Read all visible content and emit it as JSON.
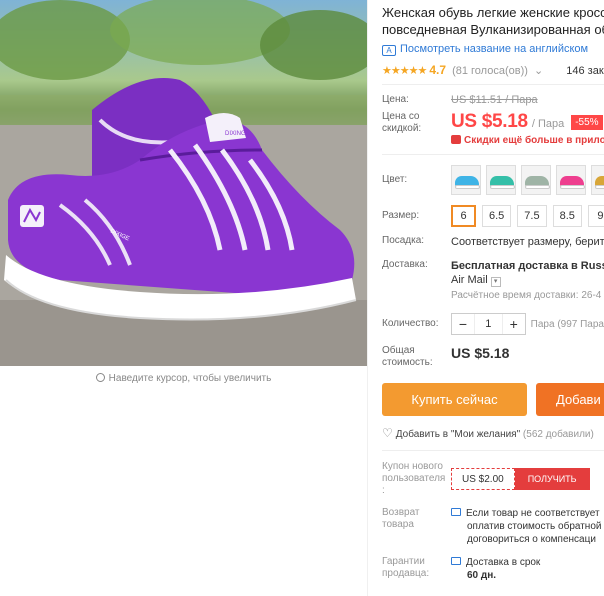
{
  "gallery": {
    "zoom_hint": "Наведите курсор, чтобы увеличить",
    "brand_print": "DIXING",
    "brand_print_2": "DIXIGE"
  },
  "product": {
    "title_line1": "Женская обувь легкие женские кроссо",
    "title_line2": "повседневная Вулканизированная обу",
    "translate_link": "Посмотреть название на английском",
    "rating_stars": "★★★★★",
    "rating_value": "4.7",
    "votes": "(81 голоса(ов))",
    "orders": "146 заказа"
  },
  "price": {
    "label": "Цена:",
    "old_value": "US $11.51 / Пара",
    "discount_label": "Цена со скидкой:",
    "value": "US $5.18",
    "per": "/ Пара",
    "discount_badge": "-55%",
    "promo": "Скидки ещё больше в приложении"
  },
  "color": {
    "label": "Цвет:",
    "swatches": [
      {
        "name": "light-blue",
        "color": "#3fb4e6"
      },
      {
        "name": "teal",
        "color": "#35bfa8"
      },
      {
        "name": "grey-green",
        "color": "#9fb4a6"
      },
      {
        "name": "pink",
        "color": "#ee3f8f"
      },
      {
        "name": "gold",
        "color": "#d8a638"
      }
    ]
  },
  "size": {
    "label": "Размер:",
    "options": [
      "6",
      "6.5",
      "7.5",
      "8.5",
      "9"
    ],
    "selected": "6"
  },
  "fit": {
    "label": "Посадка:",
    "value": "Соответствует размеру, берите с"
  },
  "delivery": {
    "label": "Доставка:",
    "value_line1": "Бесплатная доставка в Russian",
    "value_line2": "Air Mail",
    "eta": "Расчётное время доставки: 26-4"
  },
  "quantity": {
    "label": "Количество:",
    "minus": "−",
    "value": "1",
    "plus": "+",
    "available": "Пара (997 Пара"
  },
  "total": {
    "label_line1": "Общая",
    "label_line2": "стоимость:",
    "value": "US $5.18"
  },
  "buttons": {
    "buy_now": "Купить сейчас",
    "add_to_cart": "Добави"
  },
  "wishlist": {
    "label": "Добавить в \"Мои желания\"",
    "count": "(562 добавили)"
  },
  "coupon": {
    "label_line1": "Купон нового",
    "label_line2": "пользователя",
    "label_line3": ":",
    "value": "US $2.00",
    "button": "ПОЛУЧИТЬ"
  },
  "returns": {
    "label_line1": "Возврат",
    "label_line2": "товара",
    "line1": "Если товар не соответствует",
    "line2": "оплатив стоимость обратной",
    "line3": "договориться о компенсаци"
  },
  "guarantee": {
    "label_line1": "Гарантии",
    "label_line2": "продавца:",
    "line1": "Доставка в срок",
    "line2": "60 дн."
  }
}
